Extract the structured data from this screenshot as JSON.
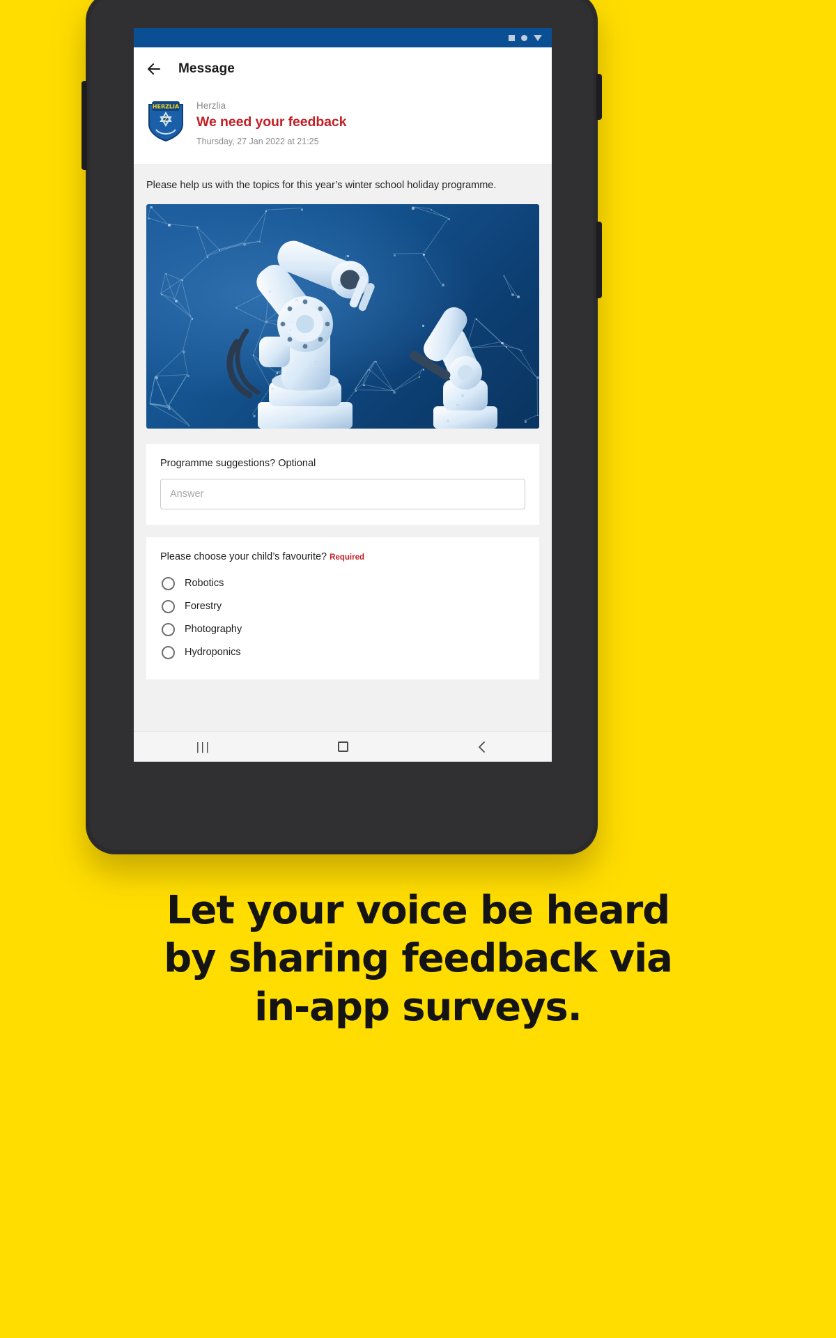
{
  "background_color": "#FFDD00",
  "status_bar": {
    "icons": [
      "square-icon",
      "dot-icon",
      "caret-down-icon"
    ],
    "background_color": "#0a4e93"
  },
  "app_bar": {
    "back_icon": "back-arrow-icon",
    "title": "Message"
  },
  "message": {
    "logo_alt": "HERZLIA",
    "logo_text": "HERZLIA",
    "sender": "Herzlia",
    "subject": "We need your feedback",
    "subject_color": "#c22026",
    "timestamp": "Thursday, 27 Jan 2022 at 21:25",
    "intro": "Please help us with the topics for this year’s winter school holiday programme.",
    "hero_image_alt": "Blue robotic arms on a network-node background"
  },
  "survey": {
    "text_question": {
      "label": "Programme suggestions? Optional",
      "optional_word": "Optional",
      "input_value": "",
      "input_placeholder": "Answer"
    },
    "choice_question": {
      "label": "Please choose your child’s favourite?",
      "required_badge": "Required",
      "required_color": "#c22026",
      "options": [
        {
          "label": "Robotics",
          "selected": false
        },
        {
          "label": "Forestry",
          "selected": false
        },
        {
          "label": "Photography",
          "selected": false
        },
        {
          "label": "Hydroponics",
          "selected": false
        }
      ]
    }
  },
  "android_nav": {
    "recents_glyph": "|||",
    "home_icon": "home-square-icon",
    "back_glyph": "‹"
  },
  "caption": {
    "line1": "Let your voice be heard",
    "line2": "by sharing feedback via",
    "line3": "in-app surveys."
  }
}
